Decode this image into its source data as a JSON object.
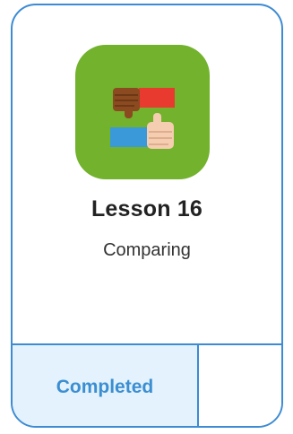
{
  "lesson": {
    "title": "Lesson 16",
    "subtitle": "Comparing",
    "icon": "thumbs-up-thumbs-down-icon"
  },
  "status": {
    "label": "Completed"
  },
  "colors": {
    "accent": "#3d8bd3",
    "tile": "#72b22d",
    "status_bg": "#e3f2fc"
  }
}
